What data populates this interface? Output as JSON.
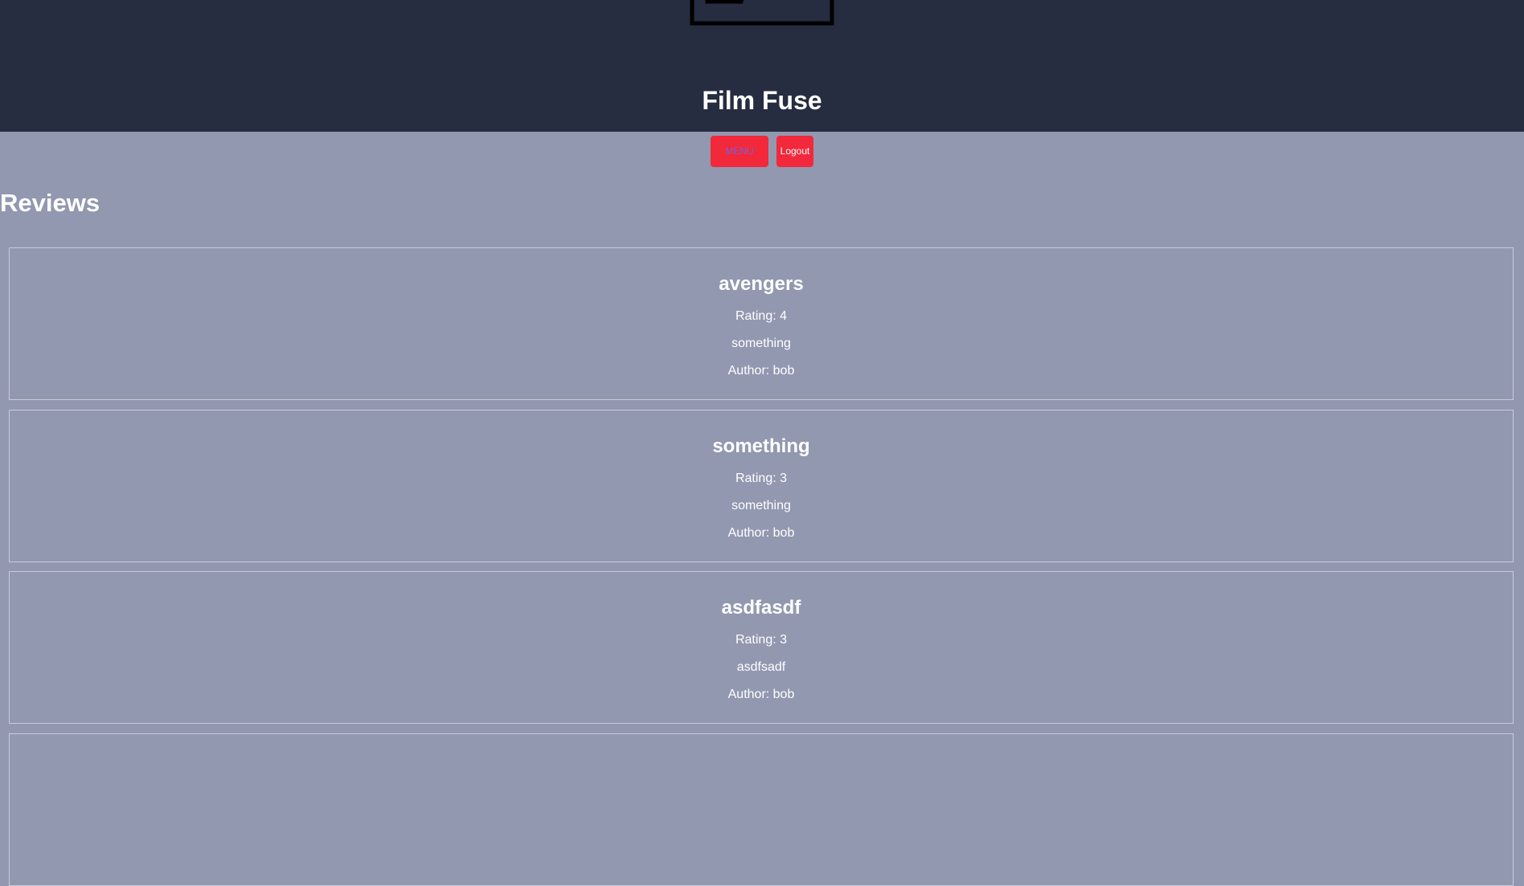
{
  "header": {
    "title": "Film Fuse",
    "logo_icon": "projector-logo-icon"
  },
  "nav": {
    "menu_label": "MENU",
    "logout_label": "Logout"
  },
  "main": {
    "heading": "Reviews",
    "reviews": [
      {
        "title": "avengers",
        "rating": "Rating: 4",
        "body": "something",
        "author": "Author: bob"
      },
      {
        "title": "something",
        "rating": "Rating: 3",
        "body": "something",
        "author": "Author: bob"
      },
      {
        "title": "asdfasdf",
        "rating": "Rating: 3",
        "body": "asdfsadf",
        "author": "Author: bob"
      }
    ]
  },
  "colors": {
    "header_bg": "#262d40",
    "page_bg": "#9298b0",
    "button_bg": "#f2283b",
    "menu_text": "#7b5fd6"
  }
}
